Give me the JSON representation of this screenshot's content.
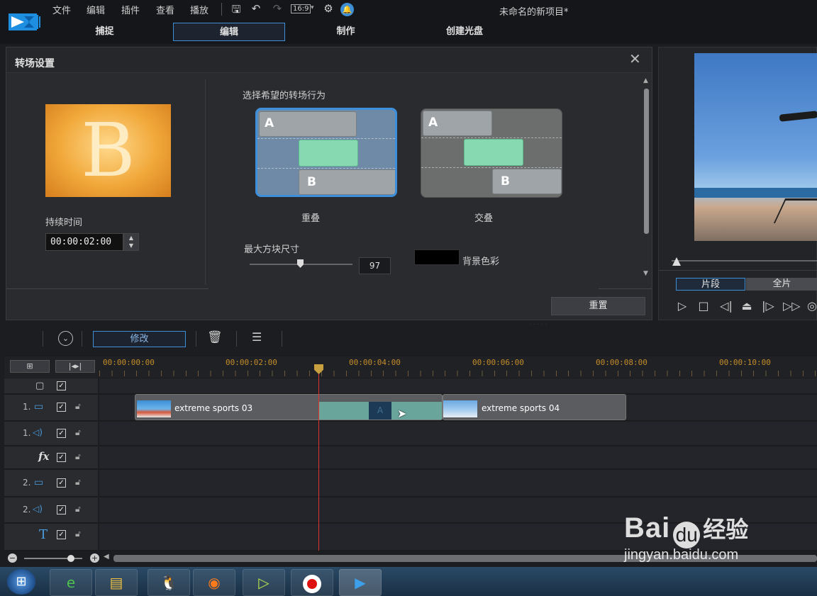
{
  "window": {
    "title": "未命名的新项目*"
  },
  "menu": [
    "文件",
    "编辑",
    "插件",
    "查看",
    "播放"
  ],
  "toolbar_icons": [
    "save-icon",
    "undo-icon",
    "redo-icon",
    "aspect-ratio-icon",
    "settings-icon",
    "notification-icon"
  ],
  "aspect_label": "16:9",
  "mode_tabs": [
    {
      "label": "捕捉",
      "active": false
    },
    {
      "label": "编辑",
      "active": true
    },
    {
      "label": "制作",
      "active": false
    },
    {
      "label": "创建光盘",
      "active": false
    }
  ],
  "dialog": {
    "title": "转场设置",
    "thumb_letter": "B",
    "duration_label": "持续时间",
    "duration_value": "00:00:02:00",
    "behavior_label": "选择希望的转场行为",
    "options": [
      {
        "label": "重叠",
        "selected": true,
        "a": "A",
        "b": "B"
      },
      {
        "label": "交叠",
        "selected": false,
        "a": "A",
        "b": "B"
      }
    ],
    "max_block_label": "最大方块尺寸",
    "max_block_value": "97",
    "bg_color_label": "背景色彩",
    "bg_color": "#000000",
    "reset_label": "重置"
  },
  "preview": {
    "segments": [
      {
        "label": "片段",
        "active": true
      },
      {
        "label": "全片",
        "active": false
      }
    ]
  },
  "timeline_toolbar": {
    "modify_label": "修改"
  },
  "ruler": {
    "ticks": [
      "00:00:00:00",
      "00:00:02:00",
      "00:00:04:00",
      "00:00:06:00",
      "00:00:08:00",
      "00:00:10:00"
    ],
    "playhead_time_seconds": 3.5
  },
  "tracks": [
    {
      "num": "",
      "icon": "overlay-icon",
      "glyph": "▢"
    },
    {
      "num": "1.",
      "icon": "video-track-icon",
      "glyph": "▭"
    },
    {
      "num": "1.",
      "icon": "audio-track-icon",
      "glyph": "◁)"
    },
    {
      "num": "",
      "icon": "fx-icon",
      "glyph": "fx"
    },
    {
      "num": "2.",
      "icon": "video-track-icon",
      "glyph": "▭"
    },
    {
      "num": "2.",
      "icon": "audio-track-icon",
      "glyph": "◁)"
    },
    {
      "num": "",
      "icon": "title-icon",
      "glyph": "T"
    }
  ],
  "clips": [
    {
      "name": "extreme sports 03"
    },
    {
      "name": "extreme sports 04"
    }
  ],
  "taskbar_apps": [
    "start-button",
    "ie-icon",
    "explorer-icon",
    "qq-icon",
    "firefox-icon",
    "app-green-icon",
    "record-icon",
    "powerdirector-icon"
  ],
  "watermark": {
    "brand": "Bai",
    "brand2": "经验",
    "url": "jingyan.baidu.com"
  }
}
